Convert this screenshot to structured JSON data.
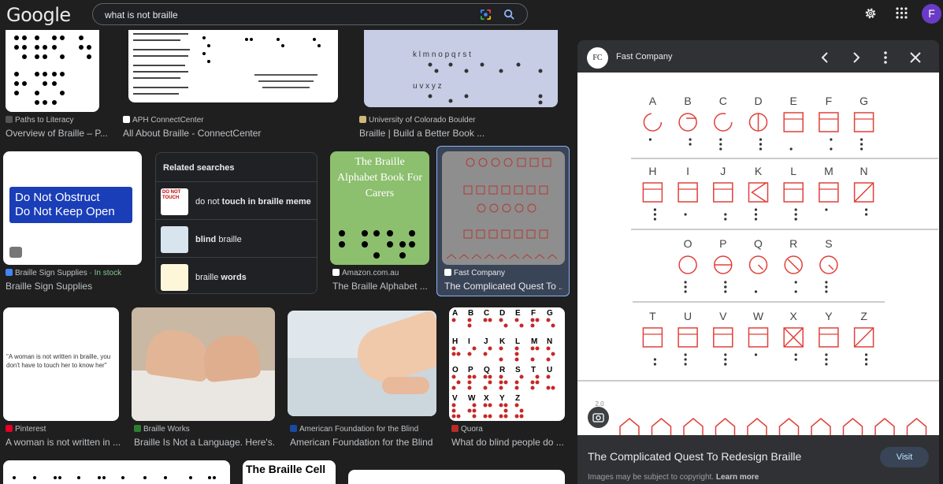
{
  "header": {
    "logo": "Google",
    "query": "what is not braille",
    "avatar_letter": "F"
  },
  "results": [
    {
      "source": "Paths to Literacy",
      "title": "Overview of Braille – P..."
    },
    {
      "source": "APH ConnectCenter",
      "title": "All About Braille - ConnectCenter"
    },
    {
      "source": "University of Colorado Boulder",
      "title": "Braille | Build a Better Book ..."
    },
    {
      "source": "Braille Sign Supplies",
      "stock": " · In stock",
      "title": "Braille Sign Supplies",
      "sign_line1": "Do Not Obstruct",
      "sign_line2": "Do Not Keep Open"
    },
    {
      "source": "Amazon.com.au",
      "title": "The Braille Alphabet ...",
      "cover": "The Braille Alphabet Book For Carers"
    },
    {
      "source": "Fast Company",
      "title": "The Complicated Quest To ..."
    },
    {
      "source": "Pinterest",
      "title": "A woman is not written in ...",
      "quote": "\"A woman is not written in braille, you don't have to touch her to know her\""
    },
    {
      "source": "Braille Works",
      "title": "Braille Is Not a Language. Here's..."
    },
    {
      "source": "American Foundation for the Blind",
      "title": "American Foundation for the Blind"
    },
    {
      "source": "Quora",
      "title": "What do blind people do ..."
    },
    {
      "title": "The Braille Cell"
    }
  ],
  "related": {
    "title": "Related searches",
    "items": [
      {
        "pre": "do ",
        "mid": "not",
        "post": " touch in braille meme",
        "thumb": "DO NOT TOUCH"
      },
      {
        "pre": "blind",
        "mid": " braille",
        "post": ""
      },
      {
        "pre": "",
        "mid": "braille ",
        "post": "words"
      }
    ]
  },
  "panel": {
    "source": "Fast Company",
    "logo": "FC",
    "title": "The Complicated Quest To Redesign Braille",
    "visit": "Visit",
    "copyright": "Images may be subject to copyright.",
    "learn_more": "Learn more",
    "rows": [
      [
        "A",
        "B",
        "C",
        "D",
        "E",
        "F",
        "G"
      ],
      [
        "H",
        "I",
        "J",
        "K",
        "L",
        "M",
        "N"
      ],
      [
        "O",
        "P",
        "Q",
        "R",
        "S"
      ],
      [
        "T",
        "U",
        "V",
        "W",
        "X",
        "Y",
        "Z"
      ]
    ],
    "page_marker": "2.0"
  },
  "colors": {
    "accent": "#e0403a",
    "selected": "#8ab4f8"
  }
}
